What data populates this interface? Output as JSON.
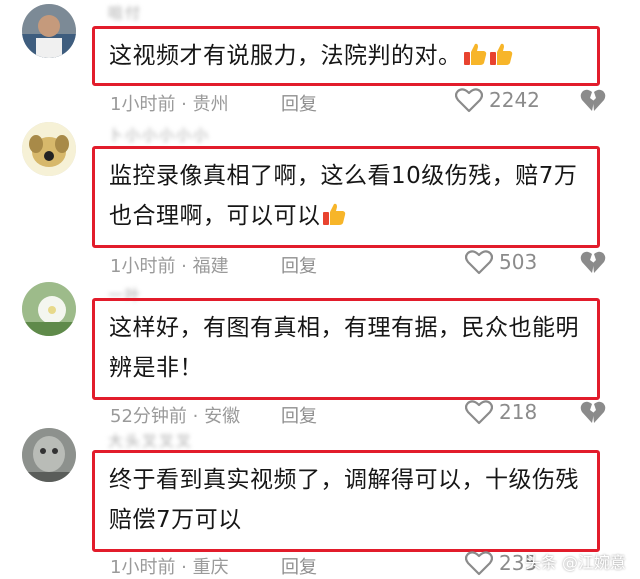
{
  "comments": [
    {
      "username": "咀付",
      "text": "这视频才有说服力，法院判的对。",
      "emoji_count": 2,
      "time_location": "1小时前 · 贵州",
      "reply_label": "回复",
      "likes": "2242"
    },
    {
      "username": "卜小小小小小",
      "text": "监控录像真相了啊，这么看10级伤残，赔7万也合理啊，可以可以",
      "emoji_count": 1,
      "time_location": "1小时前 · 福建",
      "reply_label": "回复",
      "likes": "503"
    },
    {
      "username": "一叶",
      "text": "这样好，有图有真相，有理有据，民众也能明辨是非！",
      "emoji_count": 0,
      "time_location": "52分钟前 · 安徽",
      "reply_label": "回复",
      "likes": "218"
    },
    {
      "username": "大头叉叉叉",
      "text": "终于看到真实视频了，调解得可以，十级伤残赔偿7万可以",
      "emoji_count": 0,
      "time_location": "1小时前 · 重庆",
      "reply_label": "回复",
      "likes": "235"
    }
  ],
  "watermark": "头条 @江婉意",
  "colors": {
    "highlight_border": "#e21c2b",
    "meta_gray": "#9a9a9a"
  },
  "icons": {
    "like": "heart-outline-icon",
    "dislike": "broken-heart-icon",
    "emoji": "thumbs-up-emoji-icon"
  }
}
